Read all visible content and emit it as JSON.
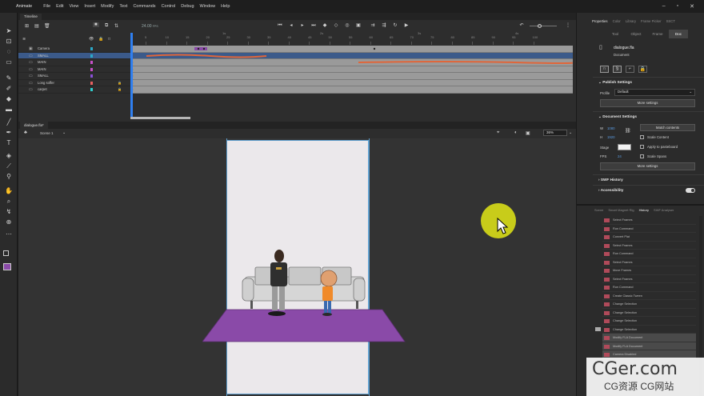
{
  "menubar": {
    "app_name": "Animate",
    "items": [
      "File",
      "Edit",
      "View",
      "Insert",
      "Modify",
      "Text",
      "Commands",
      "Control",
      "Debug",
      "Window",
      "Help"
    ]
  },
  "timeline": {
    "tab_label": "Timeline",
    "fps": "24.00",
    "fps_unit": "FPS",
    "frame_numbers": [
      "5",
      "10",
      "15",
      "20",
      "25",
      "30",
      "35",
      "40",
      "45",
      "50",
      "55",
      "60",
      "65",
      "70",
      "75",
      "80",
      "85",
      "90",
      "95",
      "100"
    ],
    "second_markers": [
      "1s",
      "2s",
      "3s",
      "4s"
    ],
    "layers": [
      {
        "name": "Camera",
        "color": "#2aa8c8",
        "selected": false,
        "locked": false
      },
      {
        "name": "SMALL",
        "color": "#2aa8c8",
        "selected": true,
        "locked": false
      },
      {
        "name": "MAIN",
        "color": "#c850c8",
        "selected": false,
        "locked": false
      },
      {
        "name": "MAIN",
        "color": "#c850c8",
        "selected": false,
        "locked": false
      },
      {
        "name": "SMALL",
        "color": "#8a50d8",
        "selected": false,
        "locked": false
      },
      {
        "name": "Long soffer",
        "color": "#e86060",
        "selected": false,
        "locked": true
      },
      {
        "name": "carpet",
        "color": "#30d0d0",
        "selected": false,
        "locked": true
      }
    ]
  },
  "document": {
    "tab_label": "dialogue.fla*",
    "scene_label": "Scene 1",
    "zoom": "36%"
  },
  "properties": {
    "tabs": [
      "Properties",
      "Color",
      "Library",
      "Frame Picker",
      "SSCT"
    ],
    "sub_tabs": [
      "Tool",
      "Object",
      "Frame",
      "Doc"
    ],
    "active_sub_tab": "Doc",
    "file_name": "dialogue.fla",
    "file_type": "Document",
    "publish_settings": {
      "heading": "Publish Settings",
      "profile_label": "Profile",
      "profile_value": "Default",
      "more_button": "More settings"
    },
    "document_settings": {
      "heading": "Document Settings",
      "w_label": "W",
      "w_value": "1080",
      "h_label": "H",
      "h_value": "1920",
      "match_contents": "Match contents",
      "scale_content": "Scale Content",
      "apply_pasteboard": "Apply to pasteboard",
      "stage_label": "Stage",
      "fps_label": "FPS",
      "fps_value": "24",
      "scale_spans": "Scale Spans",
      "more_button": "More settings"
    },
    "swf_history": "SWF History",
    "accessibility": "Accessibility"
  },
  "history_panel": {
    "tabs": [
      "Scene",
      "Smart Magnet Rig",
      "History",
      "SWF Analyser"
    ],
    "active_tab": "History",
    "items": [
      "Select Frames",
      "Run Command",
      "Convert Plat",
      "Select Frames",
      "Run Command",
      "Select Frames",
      "Move Frames",
      "Select Frames",
      "Run Command",
      "Create Classic Tween",
      "Change Selection",
      "Change Selection",
      "Change Selection",
      "Change Selection",
      "Modify FLA Document",
      "Modify FLA Document",
      "Camera Disabled"
    ]
  },
  "watermark": {
    "big": "CGer.com",
    "small": "CG资源 CG网站"
  },
  "colors": {
    "accent": "#2f7ff0",
    "cursor_highlight": "#c8cc1a",
    "carpet": "#8a4aa8",
    "stage_bg": "#ebe8eb"
  }
}
